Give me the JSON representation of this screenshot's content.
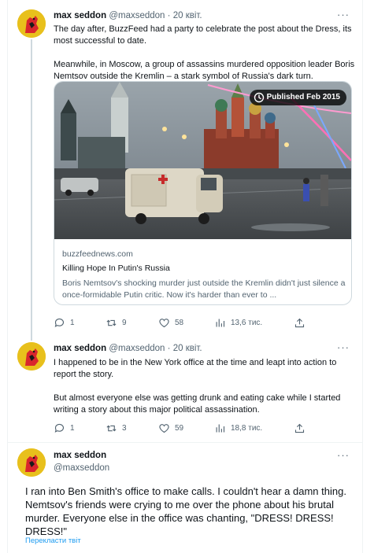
{
  "colors": {
    "accent": "#1d9bf0",
    "muted": "#536471",
    "avatar_bg": "#e8c01c"
  },
  "tweet1": {
    "name": "max seddon",
    "handle": "@maxseddon",
    "separator": "·",
    "date": "20 квіт.",
    "more_icon": "more-dots-icon",
    "text_p1": "The day after, BuzzFeed had a party to celebrate the post about the Dress, its most successful to date.",
    "text_p2": "Meanwhile, in Moscow, a group of assassins murdered opposition leader Boris Nemtsov outside the Kremlin – a stark symbol of Russia's dark turn.",
    "card": {
      "badge": "Published Feb 2015",
      "domain": "buzzfeednews.com",
      "title": "Killing Hope In Putin's Russia",
      "description": "Boris Nemtsov's shocking murder just outside the Kremlin didn't just silence a once-formidable Putin critic. Now it's harder than ever to ..."
    },
    "actions": {
      "replies": "1",
      "retweets": "9",
      "likes": "58",
      "views": "13,6 тис."
    }
  },
  "tweet2": {
    "name": "max seddon",
    "handle": "@maxseddon",
    "separator": "·",
    "date": "20 квіт.",
    "text_p1": "I happened to be in the New York office at the time and leapt into action to report the story.",
    "text_p2": "But almost everyone else was getting drunk and eating cake while I started writing a story about this major political assassination.",
    "actions": {
      "replies": "1",
      "retweets": "3",
      "likes": "59",
      "views": "18,8 тис."
    }
  },
  "tweet3": {
    "name": "max seddon",
    "handle": "@maxseddon",
    "text": "I ran into Ben Smith's office to make calls. I couldn't hear a damn thing. Nemtsov's friends were crying to me over the phone about his brutal murder. Everyone else in the office was chanting, \"DRESS! DRESS! DRESS!\"",
    "translate": "Перекласти твіт"
  }
}
